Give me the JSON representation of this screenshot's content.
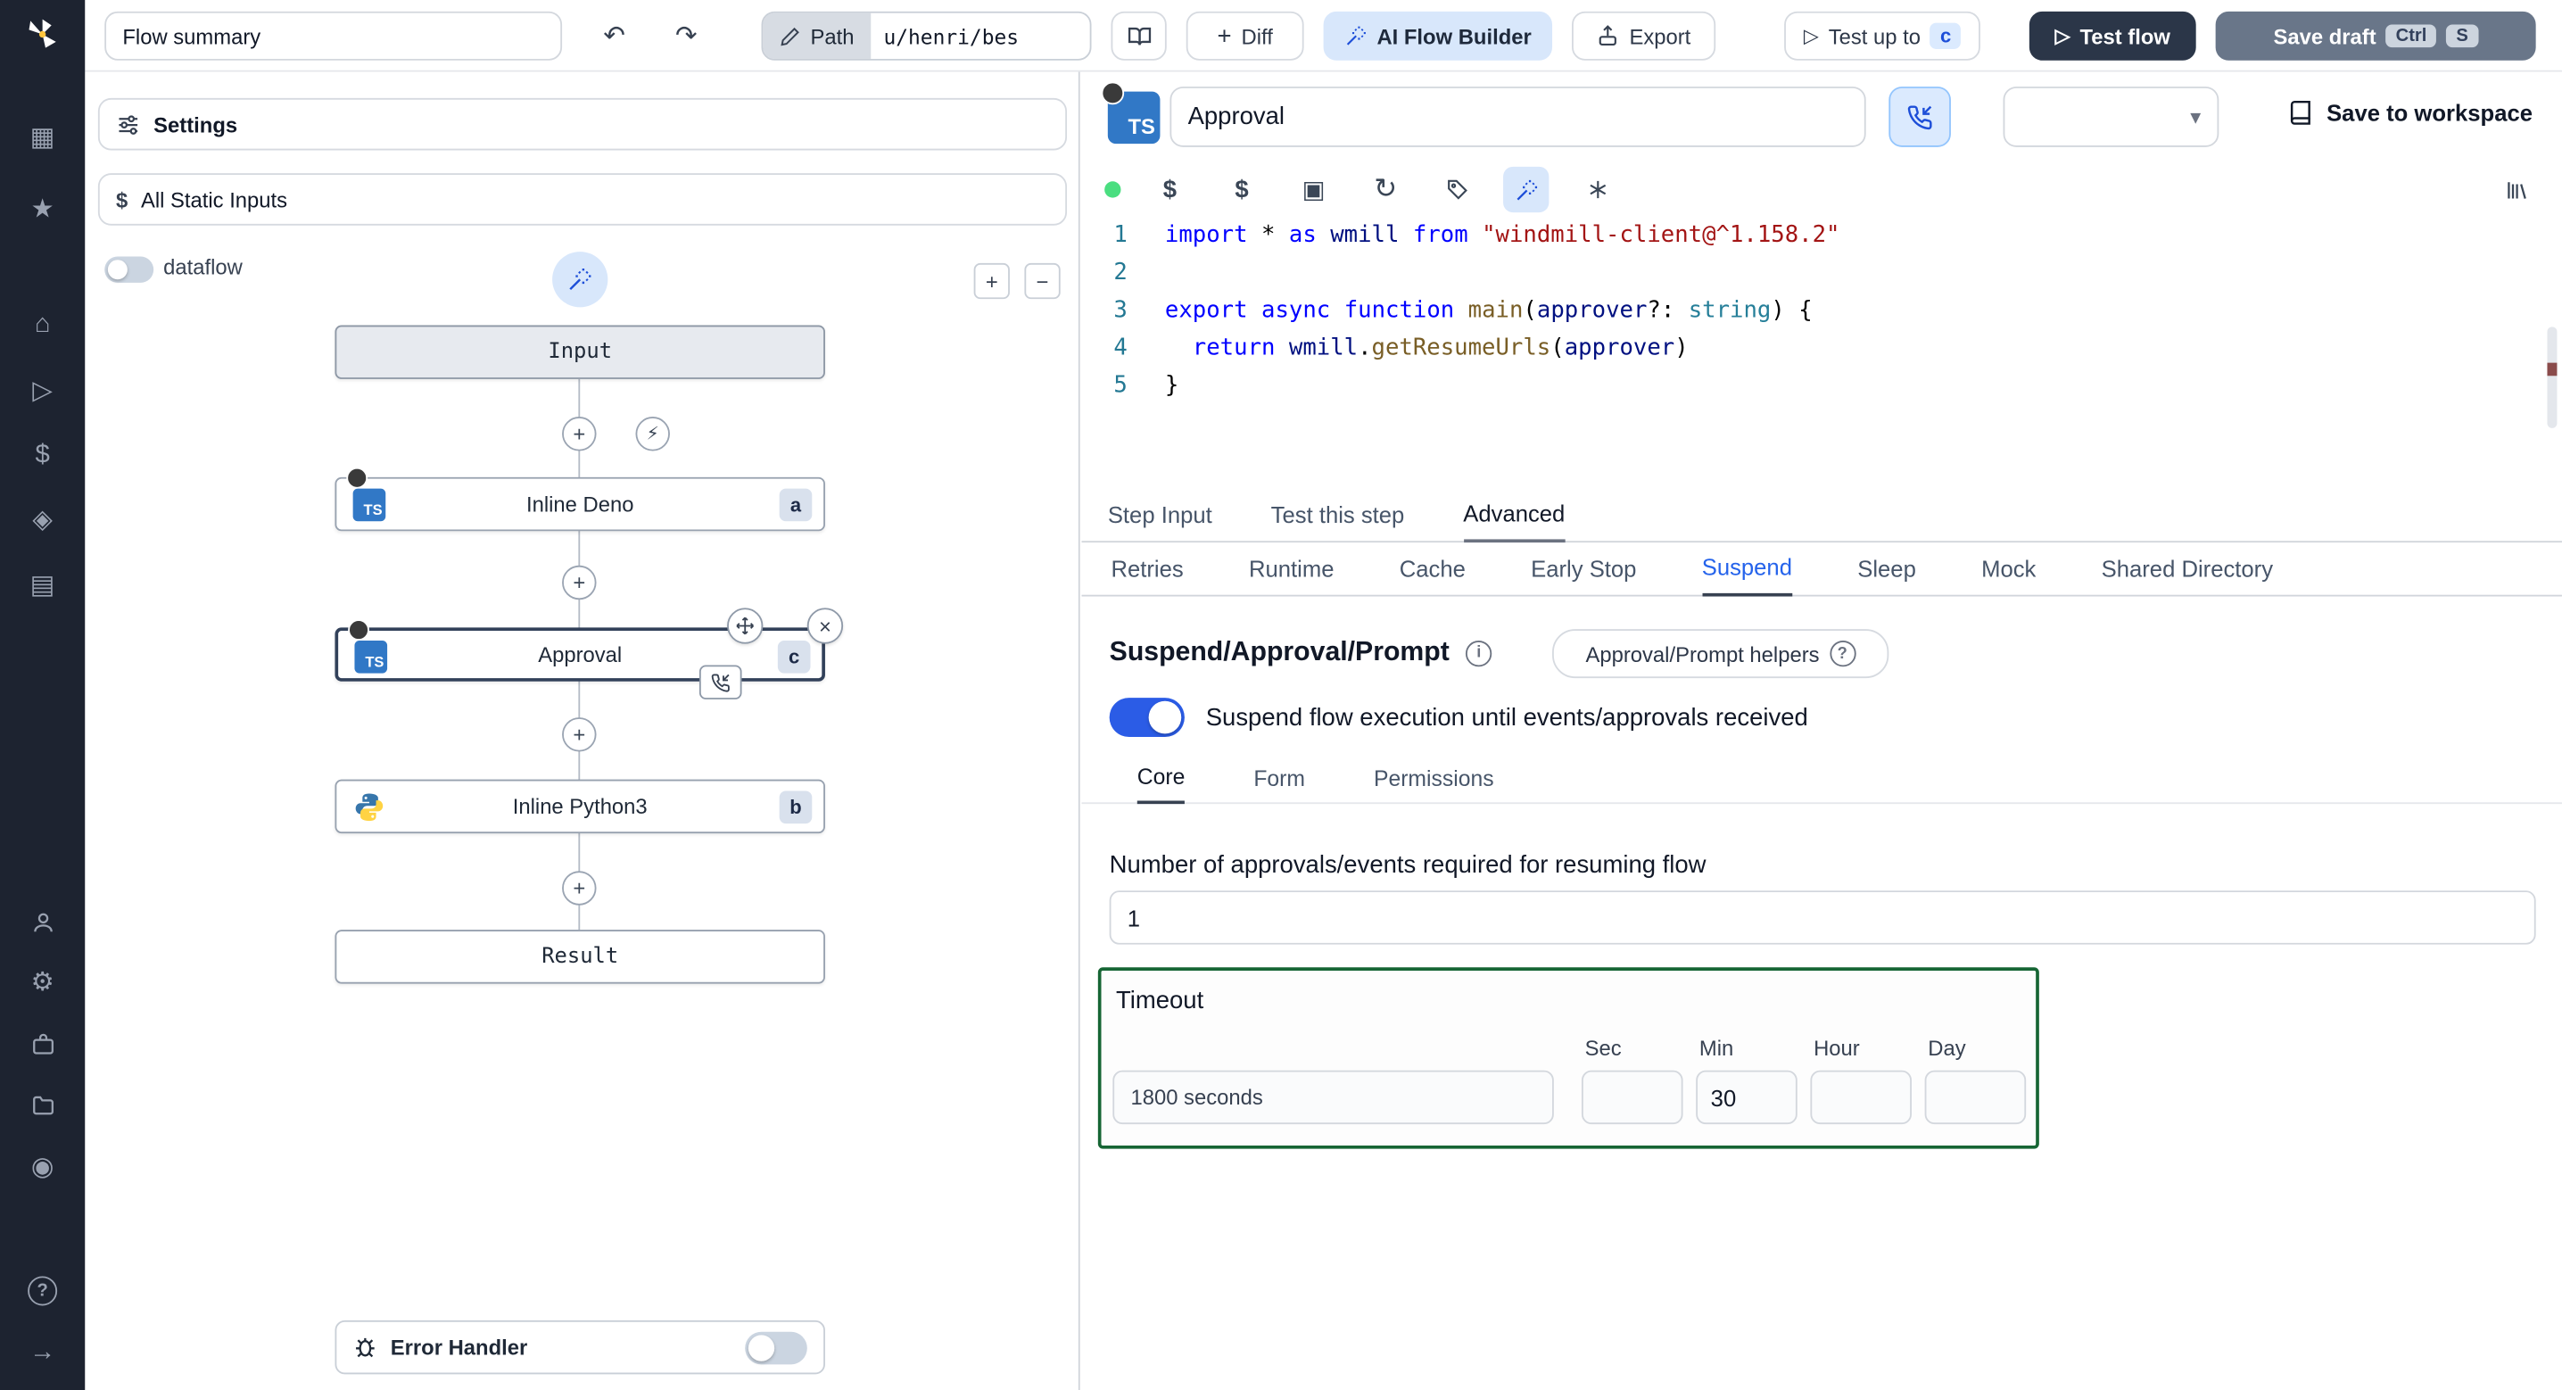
{
  "icons": {
    "grid": "▦",
    "star": "★",
    "home": "⌂",
    "play": "▷",
    "dollar": "$",
    "diamond": "◈",
    "calendar": "▤",
    "gear": "⚙",
    "eye": "◉",
    "question": "?",
    "arrow_right": "→",
    "undo": "↶",
    "redo": "↷",
    "plus": "+",
    "minus": "−",
    "close": "×",
    "chevron_down": "▾",
    "lightning": "⚡",
    "refresh": "↻",
    "package": "▣"
  },
  "topbar": {
    "flow_summary": "Flow summary",
    "path_label": "Path",
    "path_value": "u/henri/bes",
    "diff": "Diff",
    "ai_flow_builder": "AI Flow Builder",
    "export": "Export",
    "test_up_to": "Test up to",
    "test_up_to_badge": "c",
    "test_flow": "Test flow",
    "save_draft": "Save draft",
    "kbd_ctrl": "Ctrl",
    "kbd_s": "S"
  },
  "flow_panel": {
    "settings": "Settings",
    "all_static_inputs": "All Static Inputs",
    "dataflow": "dataflow",
    "nodes": {
      "input": "Input",
      "deno_label": "Inline Deno",
      "deno_badge": "a",
      "approval_label": "Approval",
      "approval_badge": "c",
      "python_label": "Inline Python3",
      "python_badge": "b",
      "result": "Result"
    },
    "error_handler": "Error Handler"
  },
  "step_panel": {
    "step_name": "Approval",
    "language_badge": "TS",
    "save_to_workspace": "Save to workspace",
    "tabs_primary": [
      "Step Input",
      "Test this step",
      "Advanced"
    ],
    "tabs_primary_selected": "Advanced",
    "tabs_secondary": [
      "Retries",
      "Runtime",
      "Cache",
      "Early Stop",
      "Suspend",
      "Sleep",
      "Mock",
      "Shared Directory"
    ],
    "tabs_secondary_selected": "Suspend",
    "suspend": {
      "heading": "Suspend/Approval/Prompt",
      "helpers_button": "Approval/Prompt helpers",
      "toggle_label": "Suspend flow execution until events/approvals received",
      "toggle_on": true,
      "tabs": [
        "Core",
        "Form",
        "Permissions"
      ],
      "tabs_selected": "Core",
      "approvals_label": "Number of approvals/events required for resuming flow",
      "approvals_value": "1",
      "timeout": {
        "label": "Timeout",
        "value": "1800 seconds",
        "unit_labels": [
          "Sec",
          "Min",
          "Hour",
          "Day"
        ],
        "sec": "",
        "min": "30",
        "hour": "",
        "day": ""
      }
    }
  },
  "code": {
    "language": "typescript",
    "line_numbers": [
      "1",
      "2",
      "3",
      "4",
      "5"
    ],
    "text": "import * as wmill from \"windmill-client@^1.158.2\"\n\nexport async function main(approver?: string) {\n  return wmill.getResumeUrls(approver)\n}",
    "lines": [
      [
        {
          "c": "kw",
          "t": "import"
        },
        {
          "c": "pl",
          "t": " * "
        },
        {
          "c": "kw",
          "t": "as"
        },
        {
          "c": "var",
          "t": " wmill "
        },
        {
          "c": "kw",
          "t": "from"
        },
        {
          "c": "str",
          "t": " \"windmill-client@^1.158.2\""
        }
      ],
      [],
      [
        {
          "c": "kw",
          "t": "export"
        },
        {
          "c": "pl",
          "t": " "
        },
        {
          "c": "kw",
          "t": "async"
        },
        {
          "c": "pl",
          "t": " "
        },
        {
          "c": "kw",
          "t": "function"
        },
        {
          "c": "fn",
          "t": " main"
        },
        {
          "c": "pl",
          "t": "("
        },
        {
          "c": "var",
          "t": "approver"
        },
        {
          "c": "pl",
          "t": "?: "
        },
        {
          "c": "type",
          "t": "string"
        },
        {
          "c": "pl",
          "t": ") {"
        }
      ],
      [
        {
          "c": "pl",
          "t": "  "
        },
        {
          "c": "kw",
          "t": "return"
        },
        {
          "c": "var",
          "t": " wmill"
        },
        {
          "c": "pl",
          "t": "."
        },
        {
          "c": "fn",
          "t": "getResumeUrls"
        },
        {
          "c": "pl",
          "t": "("
        },
        {
          "c": "var",
          "t": "approver"
        },
        {
          "c": "pl",
          "t": ")"
        }
      ],
      [
        {
          "c": "pl",
          "t": "}"
        }
      ]
    ]
  }
}
